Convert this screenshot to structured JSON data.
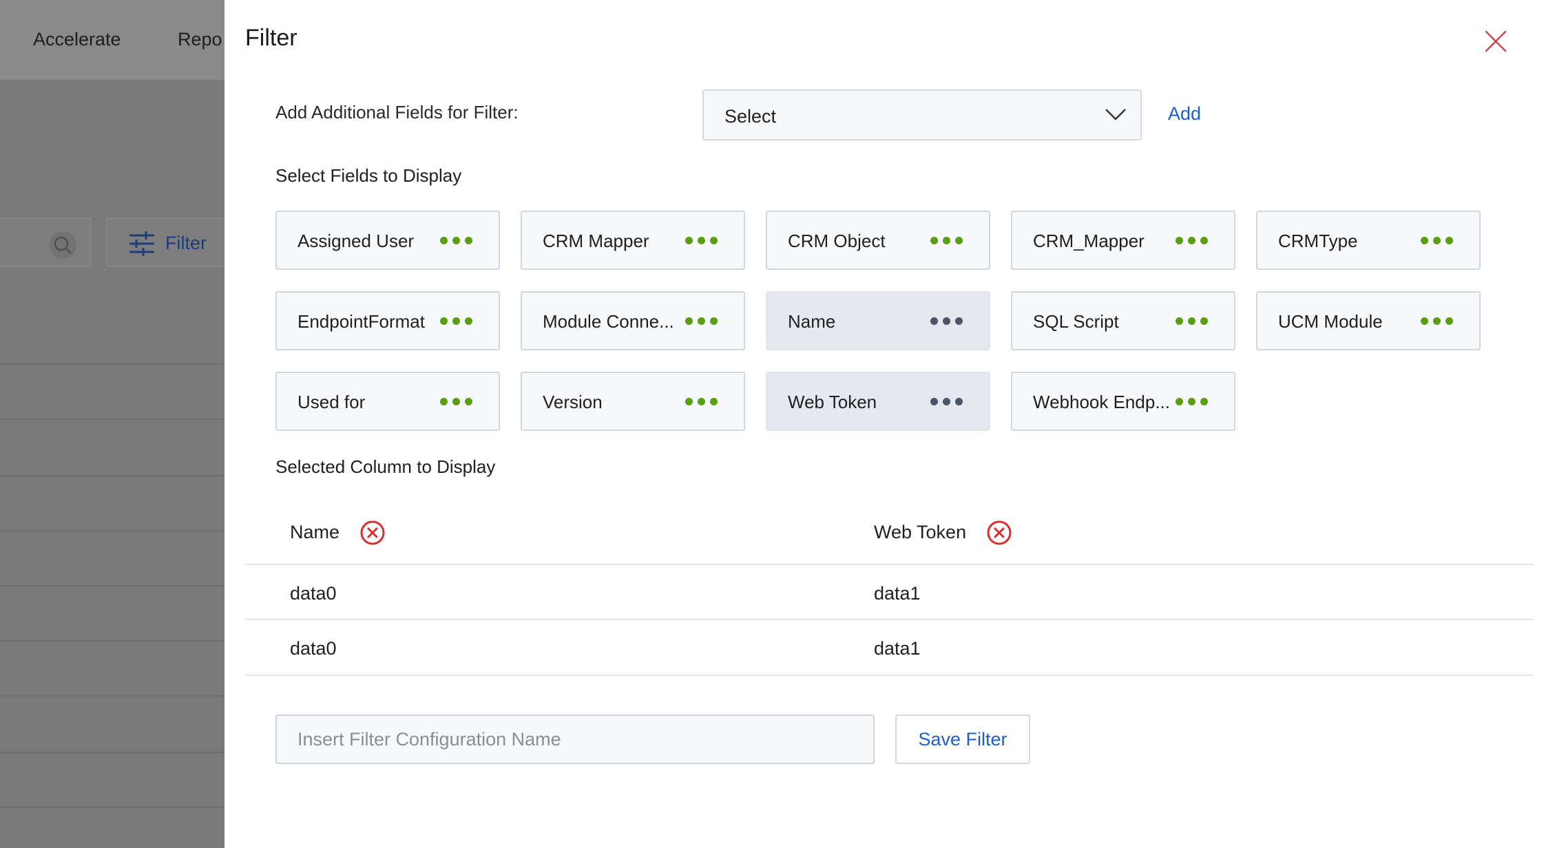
{
  "background": {
    "nav": [
      "Accelerate",
      "Repo"
    ],
    "filter_button_label": "Filter"
  },
  "panel": {
    "title": "Filter",
    "add_fields_label": "Add Additional Fields for Filter:",
    "select_value": "Select",
    "add_link": "Add",
    "select_fields_heading": "Select Fields to Display",
    "fields": [
      {
        "label": "Assigned User",
        "active": false
      },
      {
        "label": "CRM Mapper",
        "active": false
      },
      {
        "label": "CRM Object",
        "active": false
      },
      {
        "label": "CRM_Mapper",
        "active": false
      },
      {
        "label": "CRMType",
        "active": false
      },
      {
        "label": "EndpointFormat",
        "active": false
      },
      {
        "label": "Module Conne...",
        "active": false
      },
      {
        "label": "Name",
        "active": true
      },
      {
        "label": "SQL Script",
        "active": false
      },
      {
        "label": "UCM Module",
        "active": false
      },
      {
        "label": "Used for",
        "active": false
      },
      {
        "label": "Version",
        "active": false
      },
      {
        "label": "Web Token",
        "active": true
      },
      {
        "label": "Webhook Endp...",
        "active": false
      }
    ],
    "selected_columns_heading": "Selected Column to Display",
    "columns": [
      "Name",
      "Web Token"
    ],
    "rows": [
      [
        "data0",
        "data1"
      ],
      [
        "data0",
        "data1"
      ]
    ],
    "config_name_placeholder": "Insert Filter Configuration Name",
    "save_button": "Save Filter"
  },
  "colors": {
    "accent": "#1f5fc9",
    "dots_green": "#5a9e12",
    "remove_red": "#d32f2f"
  }
}
